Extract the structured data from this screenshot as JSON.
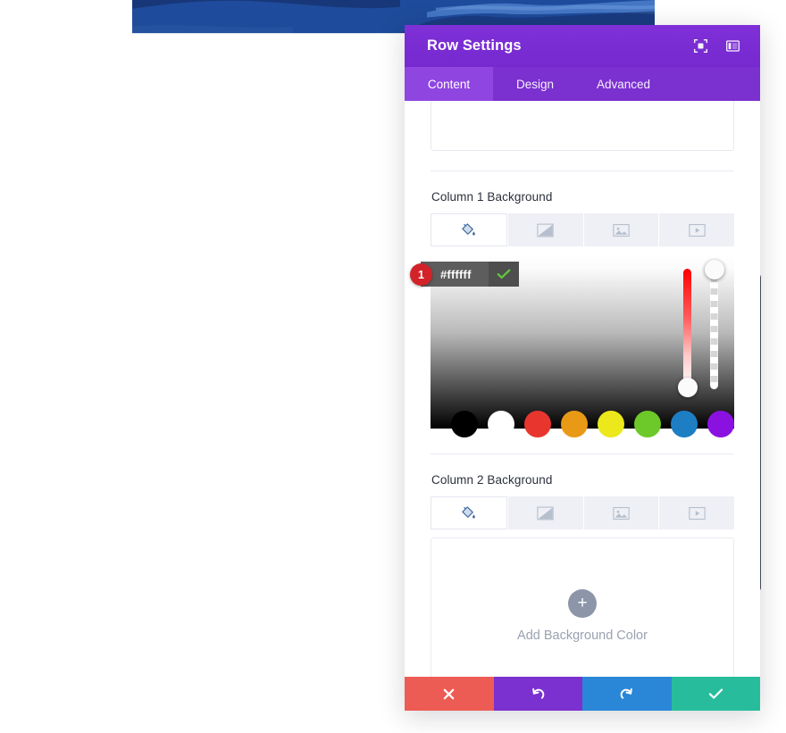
{
  "page": {
    "banner": {
      "name": "hero-banner-image",
      "alt": "blue ocean wave illustration",
      "base_color": "#1e4b9b",
      "wave_color_dark": "#17306e",
      "wave_color_light": "#3a6ec0"
    },
    "scrollbar": {
      "name": "modal-scrollbar",
      "color": "#4a5361"
    }
  },
  "modal": {
    "title": "Row Settings",
    "header_icons": [
      {
        "name": "expand-view-icon",
        "label": "Expand"
      },
      {
        "name": "layout-panel-icon",
        "label": "Change Layout"
      }
    ],
    "tabs": [
      {
        "label": "Content",
        "active": true
      },
      {
        "label": "Design",
        "active": false
      },
      {
        "label": "Advanced",
        "active": false
      }
    ],
    "accent_color": "#7b30d0",
    "active_tab_color": "#8f46e0"
  },
  "sections": [
    {
      "id": "column1",
      "label": "Column 1 Background",
      "bg_type_tabs": [
        {
          "name": "background-color-icon",
          "label": "Background Color",
          "active": true
        },
        {
          "name": "background-gradient-icon",
          "label": "Background Gradient",
          "active": false
        },
        {
          "name": "background-image-icon",
          "label": "Background Image",
          "active": false
        },
        {
          "name": "background-video-icon",
          "label": "Background Video",
          "active": false
        }
      ],
      "picker": {
        "hex_value": "#ffffff",
        "hex_placeholder": "#ffffff",
        "badge": "1",
        "confirm_label": "Apply color",
        "hue_handle_position": "bottom",
        "alpha_handle_position": "top",
        "swatches": [
          {
            "label": "black",
            "color": "#000000"
          },
          {
            "label": "white",
            "color": "#ffffff"
          },
          {
            "label": "red",
            "color": "#e8352e"
          },
          {
            "label": "orange",
            "color": "#e89a16"
          },
          {
            "label": "yellow",
            "color": "#ece81b"
          },
          {
            "label": "green",
            "color": "#6dc92a"
          },
          {
            "label": "blue",
            "color": "#1d7ec4"
          },
          {
            "label": "purple",
            "color": "#8b11e0"
          }
        ]
      }
    },
    {
      "id": "column2",
      "label": "Column 2 Background",
      "bg_type_tabs": [
        {
          "name": "background-color-icon",
          "label": "Background Color",
          "active": true
        },
        {
          "name": "background-gradient-icon",
          "label": "Background Gradient",
          "active": false
        },
        {
          "name": "background-image-icon",
          "label": "Background Image",
          "active": false
        },
        {
          "name": "background-video-icon",
          "label": "Background Video",
          "active": false
        }
      ],
      "add_background": {
        "plus": "+",
        "text": "Add Background Color"
      }
    }
  ],
  "footer": {
    "buttons": [
      {
        "name": "discard-changes-button",
        "icon": "close-icon",
        "glyph": "✖",
        "color": "#ed5c54"
      },
      {
        "name": "undo-button",
        "icon": "undo-icon",
        "glyph": "↺",
        "color": "#7b30d0"
      },
      {
        "name": "redo-button",
        "icon": "redo-icon",
        "glyph": "↻",
        "color": "#2a87d8"
      },
      {
        "name": "save-changes-button",
        "icon": "check-icon",
        "glyph": "✔",
        "color": "#27bd9c"
      }
    ]
  }
}
